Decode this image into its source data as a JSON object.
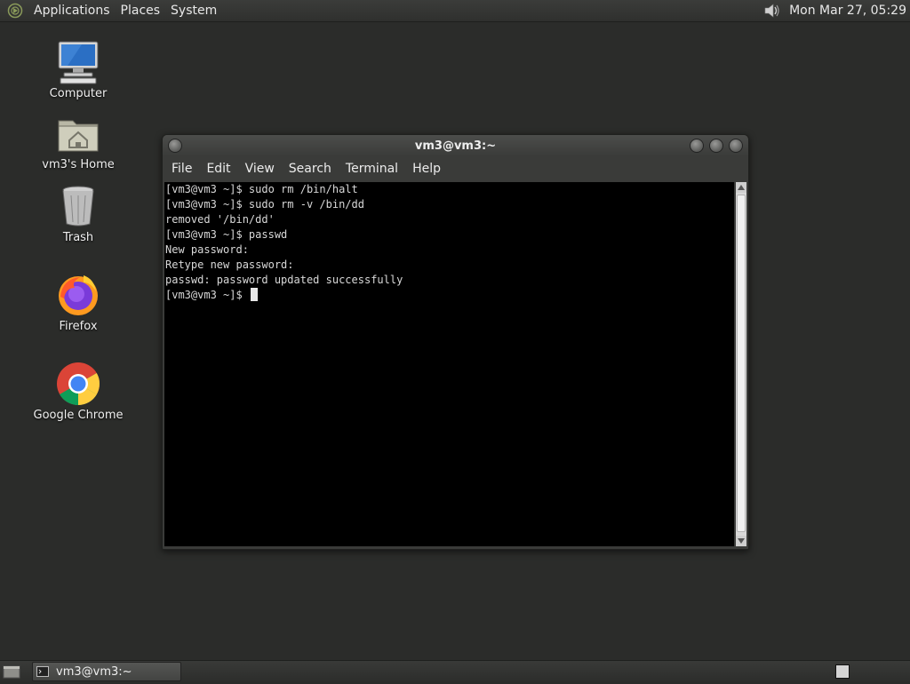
{
  "top_panel": {
    "menus": [
      "Applications",
      "Places",
      "System"
    ],
    "clock": "Mon Mar 27, 05:29"
  },
  "desktop": {
    "icons": [
      {
        "label": "Computer",
        "icon": "computer-icon"
      },
      {
        "label": "vm3's Home",
        "icon": "home-folder-icon"
      },
      {
        "label": "Trash",
        "icon": "trash-icon"
      },
      {
        "label": "Firefox",
        "icon": "firefox-icon"
      },
      {
        "label": "Google Chrome",
        "icon": "chrome-icon"
      }
    ]
  },
  "terminal": {
    "title": "vm3@vm3:~",
    "menus": [
      "File",
      "Edit",
      "View",
      "Search",
      "Terminal",
      "Help"
    ],
    "lines": [
      "[vm3@vm3 ~]$ sudo rm /bin/halt",
      "[vm3@vm3 ~]$ sudo rm -v /bin/dd",
      "removed '/bin/dd'",
      "[vm3@vm3 ~]$ passwd",
      "New password:",
      "Retype new password:",
      "passwd: password updated successfully"
    ],
    "prompt": "[vm3@vm3 ~]$ "
  },
  "taskbar": {
    "window_button": "vm3@vm3:~"
  },
  "colors": {
    "desktop_bg": "#2b2c2a",
    "terminal_bg": "#000000",
    "terminal_fg": "#d8d8d8"
  }
}
